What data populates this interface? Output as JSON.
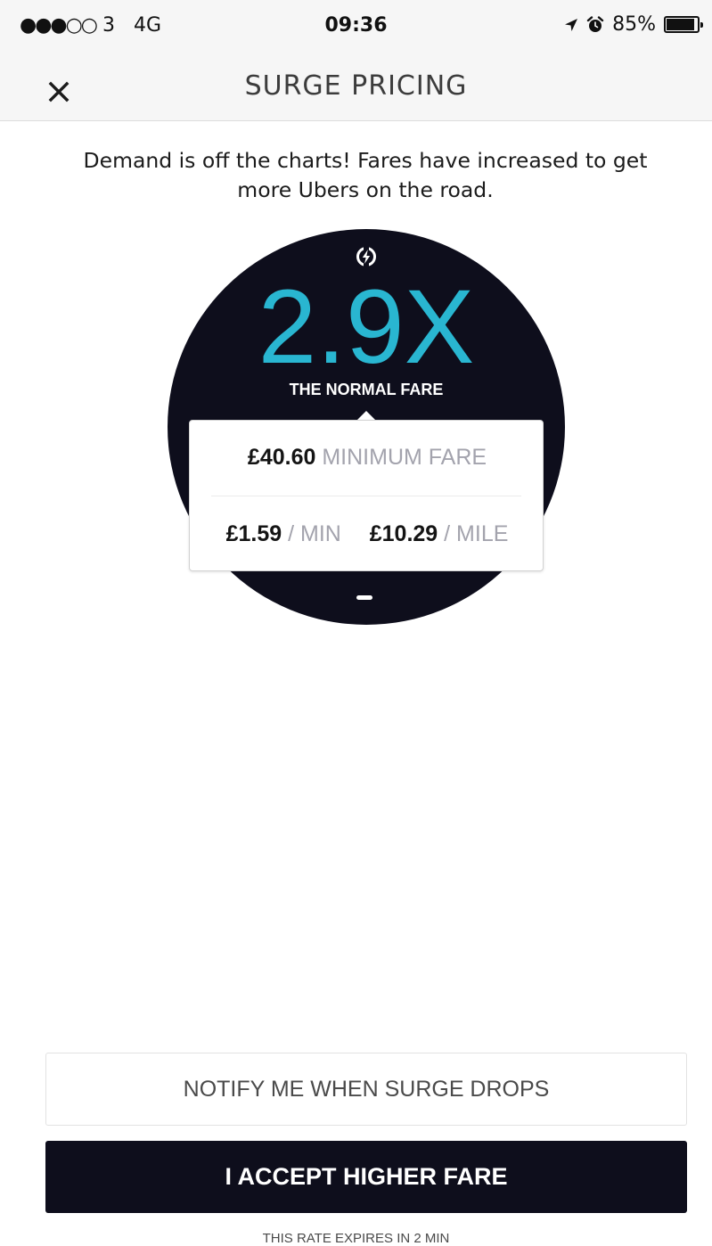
{
  "status_bar": {
    "signal": "●●●○○",
    "carrier": "3",
    "network": "4G",
    "time": "09:36",
    "battery": "85%",
    "battery_level": 0.85,
    "icons": [
      "location-arrow-icon",
      "alarm-clock-icon",
      "battery-icon"
    ]
  },
  "header": {
    "close_icon": "close-icon",
    "title": "SURGE PRICING"
  },
  "message": "Demand is off the charts! Fares have increased to get more Ubers on the road.",
  "surge": {
    "icon": "surge-bolt-icon",
    "multiplier": "2.9X",
    "caption": "THE NORMAL FARE"
  },
  "fare": {
    "minimum_amount": "£40.60",
    "minimum_label": "MINIMUM FARE",
    "per_min_amount": "£1.59",
    "per_min_label": "/ MIN",
    "per_mile_amount": "£10.29",
    "per_mile_label": "/ MILE"
  },
  "buttons": {
    "notify": "NOTIFY ME WHEN SURGE DROPS",
    "accept": "I ACCEPT HIGHER FARE"
  },
  "expiry": "THIS RATE EXPIRES IN 2 MIN",
  "colors": {
    "surge_accent": "#29b6d1",
    "dark": "#0e0e1c",
    "muted": "#a3a3ad"
  }
}
